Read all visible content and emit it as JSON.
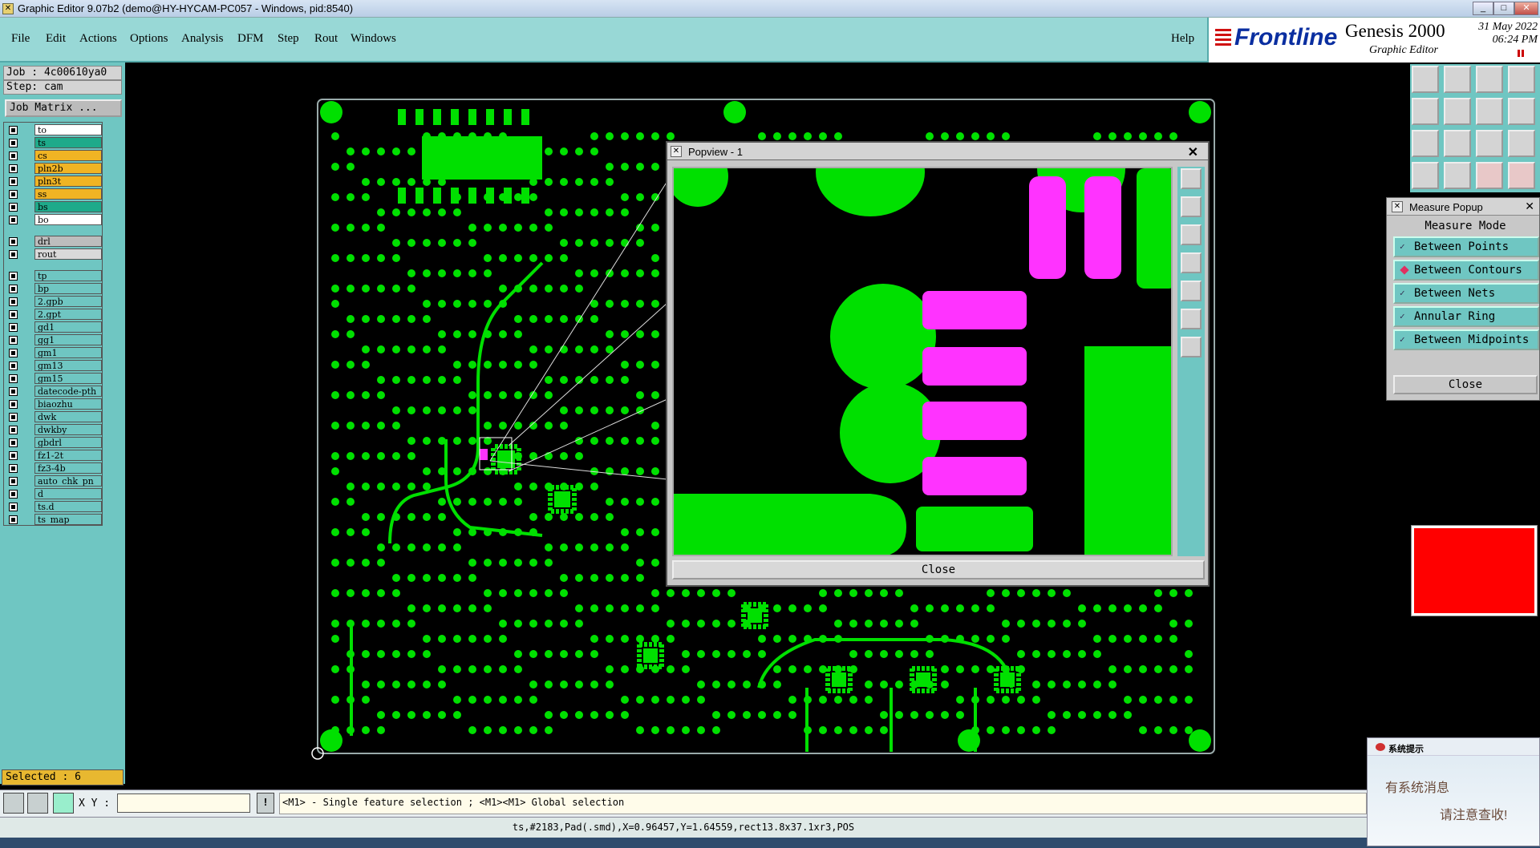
{
  "window": {
    "title": "Graphic Editor 9.07b2 (demo@HY-HYCAM-PC057 - Windows, pid:8540)",
    "btn_min": "_",
    "btn_max": "□",
    "btn_close": "✕"
  },
  "menu": {
    "items": [
      "File",
      "Edit",
      "Actions",
      "Options",
      "Analysis",
      "DFM",
      "Step",
      "Rout",
      "Windows"
    ],
    "help": "Help"
  },
  "brand": {
    "logo": "Frontline",
    "product": "Genesis 2000",
    "subtitle": "Graphic Editor",
    "date": "31 May 2022",
    "time": "06:24 PM"
  },
  "job": {
    "job_line": "Job : 4c00610ya0",
    "step_line": "Step: cam",
    "job_matrix": "Job Matrix ..."
  },
  "layers": [
    {
      "name": "to",
      "color": "#ffffff"
    },
    {
      "name": "ts",
      "color": "#1eaa8a"
    },
    {
      "name": "cs",
      "color": "#f0b424"
    },
    {
      "name": "pln2b",
      "color": "#f0b424"
    },
    {
      "name": "pln3t",
      "color": "#f0b424"
    },
    {
      "name": "ss",
      "color": "#f0b424"
    },
    {
      "name": "bs",
      "color": "#1eaa8a"
    },
    {
      "name": "bo",
      "color": "#ffffff"
    },
    {
      "name": "drl",
      "color": "#bdbdbd"
    },
    {
      "name": "rout",
      "color": "#d9d9d9"
    },
    {
      "name": "tp",
      "color": "#6fc6c2"
    },
    {
      "name": "bp",
      "color": "#6fc6c2"
    },
    {
      "name": "2.gpb",
      "color": "#6fc6c2"
    },
    {
      "name": "2.gpt",
      "color": "#6fc6c2"
    },
    {
      "name": "gd1",
      "color": "#6fc6c2"
    },
    {
      "name": "gg1",
      "color": "#6fc6c2"
    },
    {
      "name": "gm1",
      "color": "#6fc6c2"
    },
    {
      "name": "gm13",
      "color": "#6fc6c2"
    },
    {
      "name": "gm15",
      "color": "#6fc6c2"
    },
    {
      "name": "datecode-pth",
      "color": "#6fc6c2"
    },
    {
      "name": "biaozhu",
      "color": "#6fc6c2"
    },
    {
      "name": "dwk",
      "color": "#6fc6c2"
    },
    {
      "name": "dwkby",
      "color": "#6fc6c2"
    },
    {
      "name": "gbdrl",
      "color": "#6fc6c2"
    },
    {
      "name": "fz1-2t",
      "color": "#6fc6c2"
    },
    {
      "name": "fz3-4b",
      "color": "#6fc6c2"
    },
    {
      "name": "auto_chk_pn",
      "color": "#6fc6c2"
    },
    {
      "name": "d",
      "color": "#6fc6c2"
    },
    {
      "name": "ts.d",
      "color": "#6fc6c2"
    },
    {
      "name": "ts_map",
      "color": "#6fc6c2"
    }
  ],
  "selected": "Selected : 6",
  "xy": {
    "label": "X Y :",
    "value": ""
  },
  "hint": "<M1> - Single feature selection ; <M1><M1> Global selection",
  "status": "ts,#2183,Pad(.smd),X=0.96457,Y=1.64559,rect13.8x37.1xr3,POS",
  "popview": {
    "title": "Popview - 1",
    "close_label": "Close"
  },
  "measure": {
    "title": "Measure Popup",
    "mode_label": "Measure Mode",
    "options": [
      {
        "label": "Between Points",
        "selected": false
      },
      {
        "label": "Between Contours",
        "selected": true
      },
      {
        "label": "Between Nets",
        "selected": false
      },
      {
        "label": "Annular Ring",
        "selected": false
      },
      {
        "label": "Between Midpoints",
        "selected": false
      }
    ],
    "close_label": "Close"
  },
  "notice": {
    "title": "系统提示",
    "line1": "有系统消息",
    "line2": "请注意查收!"
  },
  "colors": {
    "pad_green": "#00e000",
    "smd_magenta": "#ff33ff",
    "panel_teal": "#6fc6c2",
    "menu_teal": "#98d8d6"
  }
}
